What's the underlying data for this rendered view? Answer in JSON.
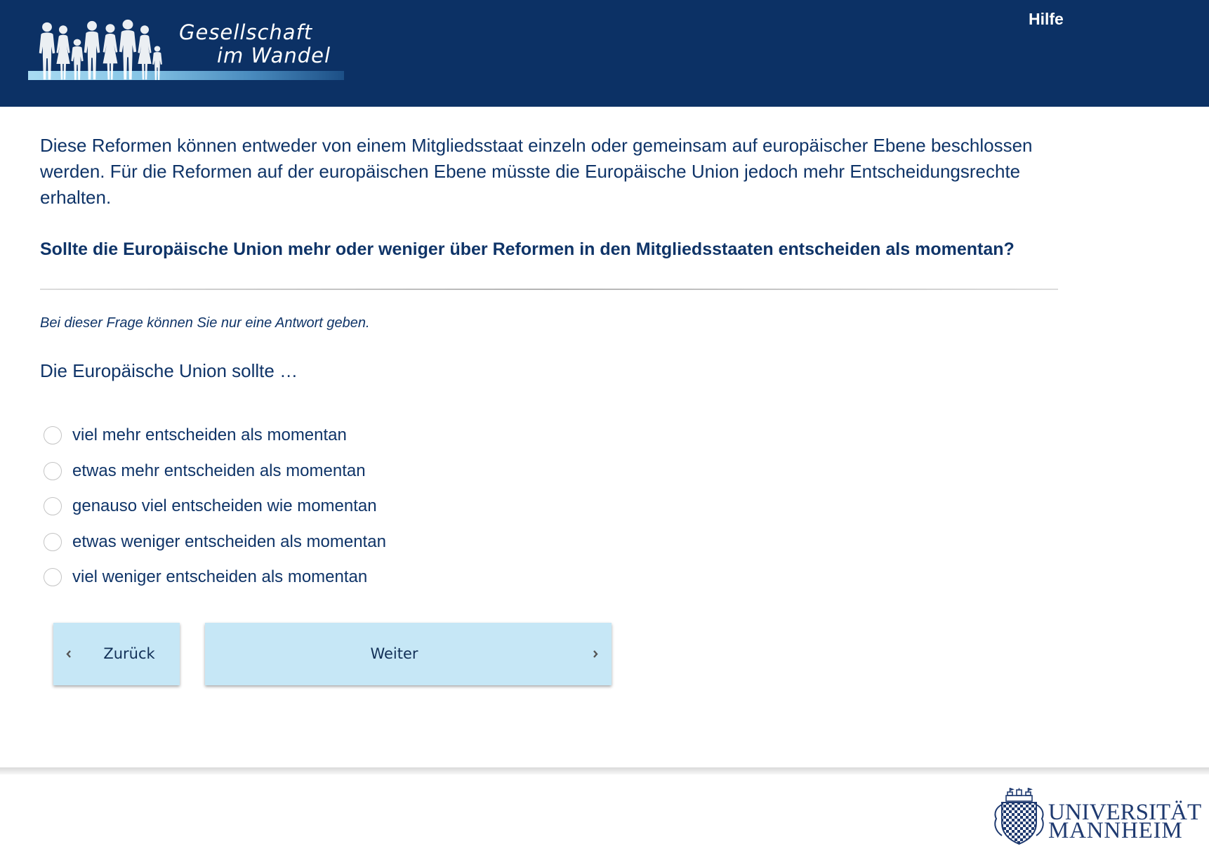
{
  "header": {
    "logo": {
      "line1": "Gesellschaft",
      "line2": "im Wandel"
    },
    "help_link": "Hilfe"
  },
  "question": {
    "intro": "Diese Reformen können entweder von einem Mitgliedsstaat einzeln oder gemeinsam auf europäischer Ebene beschlossen werden. Für die Reformen auf der europäischen Ebene müsste die Europäische Union jedoch mehr Entscheidungsrechte erhalten.",
    "title": "Sollte die Europäische Union mehr oder weniger über Reformen in den Mitgliedsstaaten entscheiden als momentan?",
    "instruction": "Bei dieser Frage können Sie nur eine Antwort geben.",
    "stem": "Die Europäische Union sollte …",
    "options": [
      {
        "label": "viel mehr entscheiden als momentan",
        "selected": false
      },
      {
        "label": "etwas mehr entscheiden als momentan",
        "selected": false
      },
      {
        "label": "genauso viel entscheiden wie momentan",
        "selected": false
      },
      {
        "label": "etwas weniger entscheiden als momentan",
        "selected": false
      },
      {
        "label": "viel weniger entscheiden als momentan",
        "selected": false
      }
    ]
  },
  "navigation": {
    "back": {
      "label": "Zurück",
      "icon": "chevron-left-icon"
    },
    "next": {
      "label": "Weiter",
      "icon": "chevron-right-icon"
    }
  },
  "footer": {
    "university_logo": {
      "line1": "UNIVERSITÄT",
      "line2": "MANNHEIM"
    }
  },
  "colors": {
    "header_background": "#0c3165",
    "text": "#0f3468",
    "button_background": "#c6e7f6"
  }
}
